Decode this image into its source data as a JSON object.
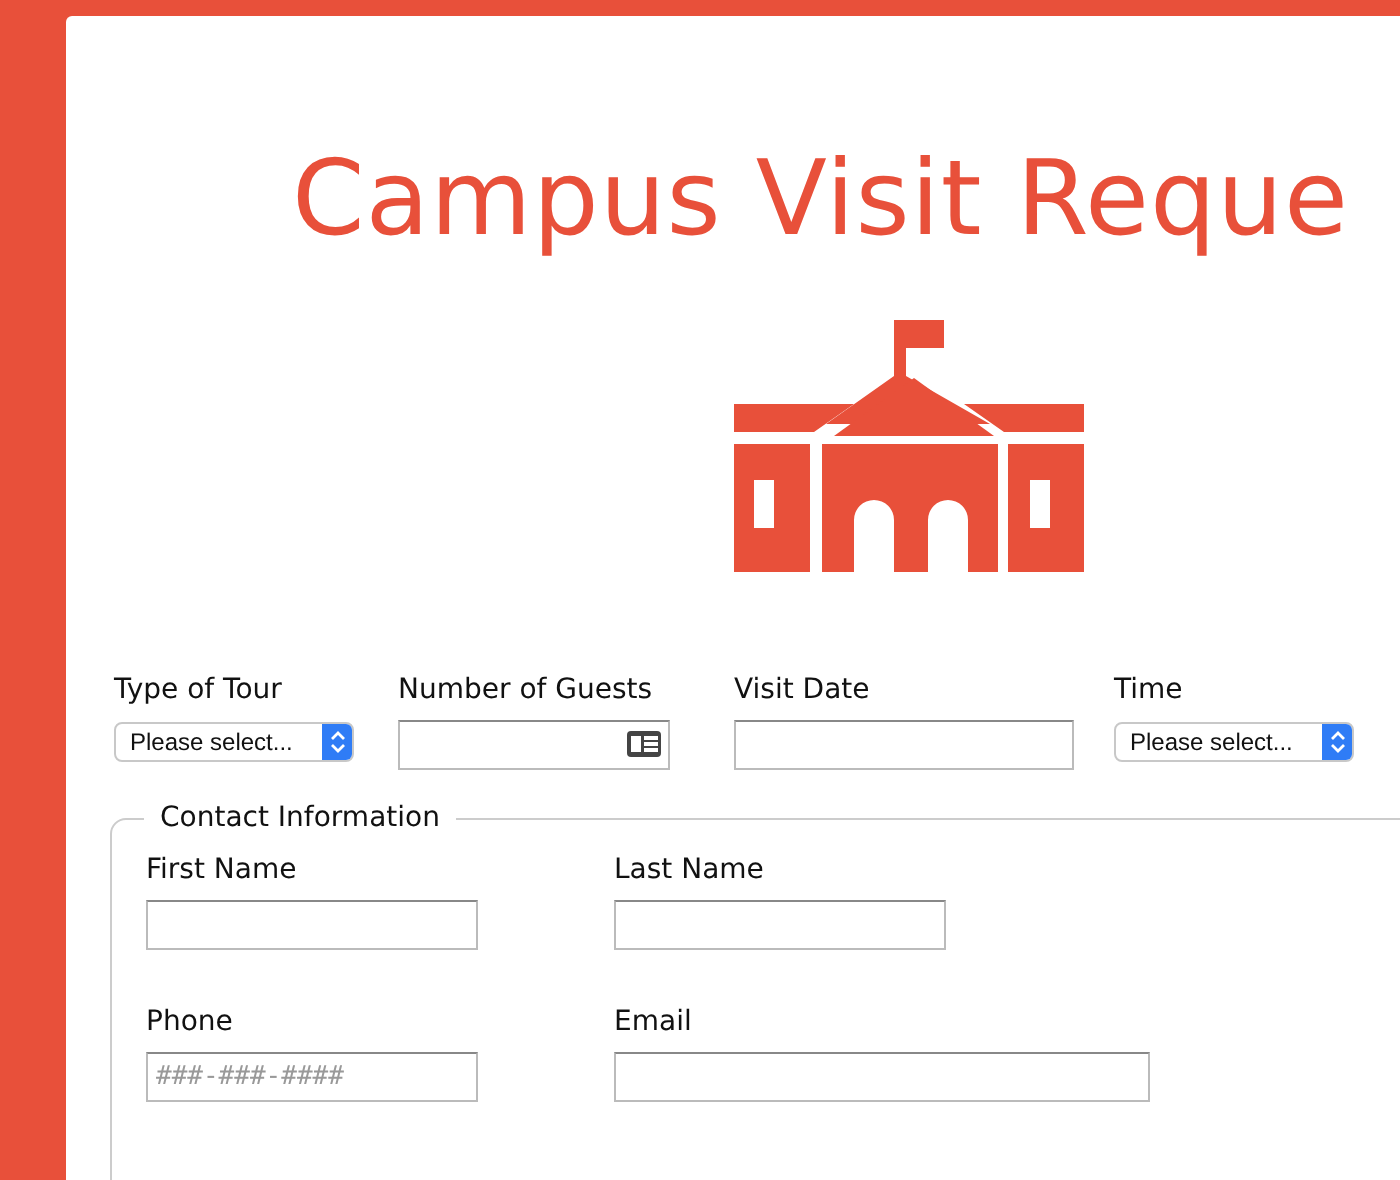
{
  "title": "Campus Visit Reque",
  "top_fields": [
    {
      "kind": "select",
      "label": "Type of Tour",
      "placeholder": "Please select..."
    },
    {
      "kind": "card",
      "label": "Number of Guests"
    },
    {
      "kind": "text",
      "label": "Visit Date"
    },
    {
      "kind": "select",
      "label": "Time",
      "placeholder": "Please select..."
    }
  ],
  "contact": {
    "legend": "Contact Information",
    "fields": [
      {
        "label": "First Name",
        "kind": "short"
      },
      {
        "label": "Last Name",
        "kind": "short"
      },
      {
        "label": "Phone",
        "kind": "short",
        "placeholder": "###-###-####"
      },
      {
        "label": "Email",
        "kind": "long"
      }
    ]
  }
}
